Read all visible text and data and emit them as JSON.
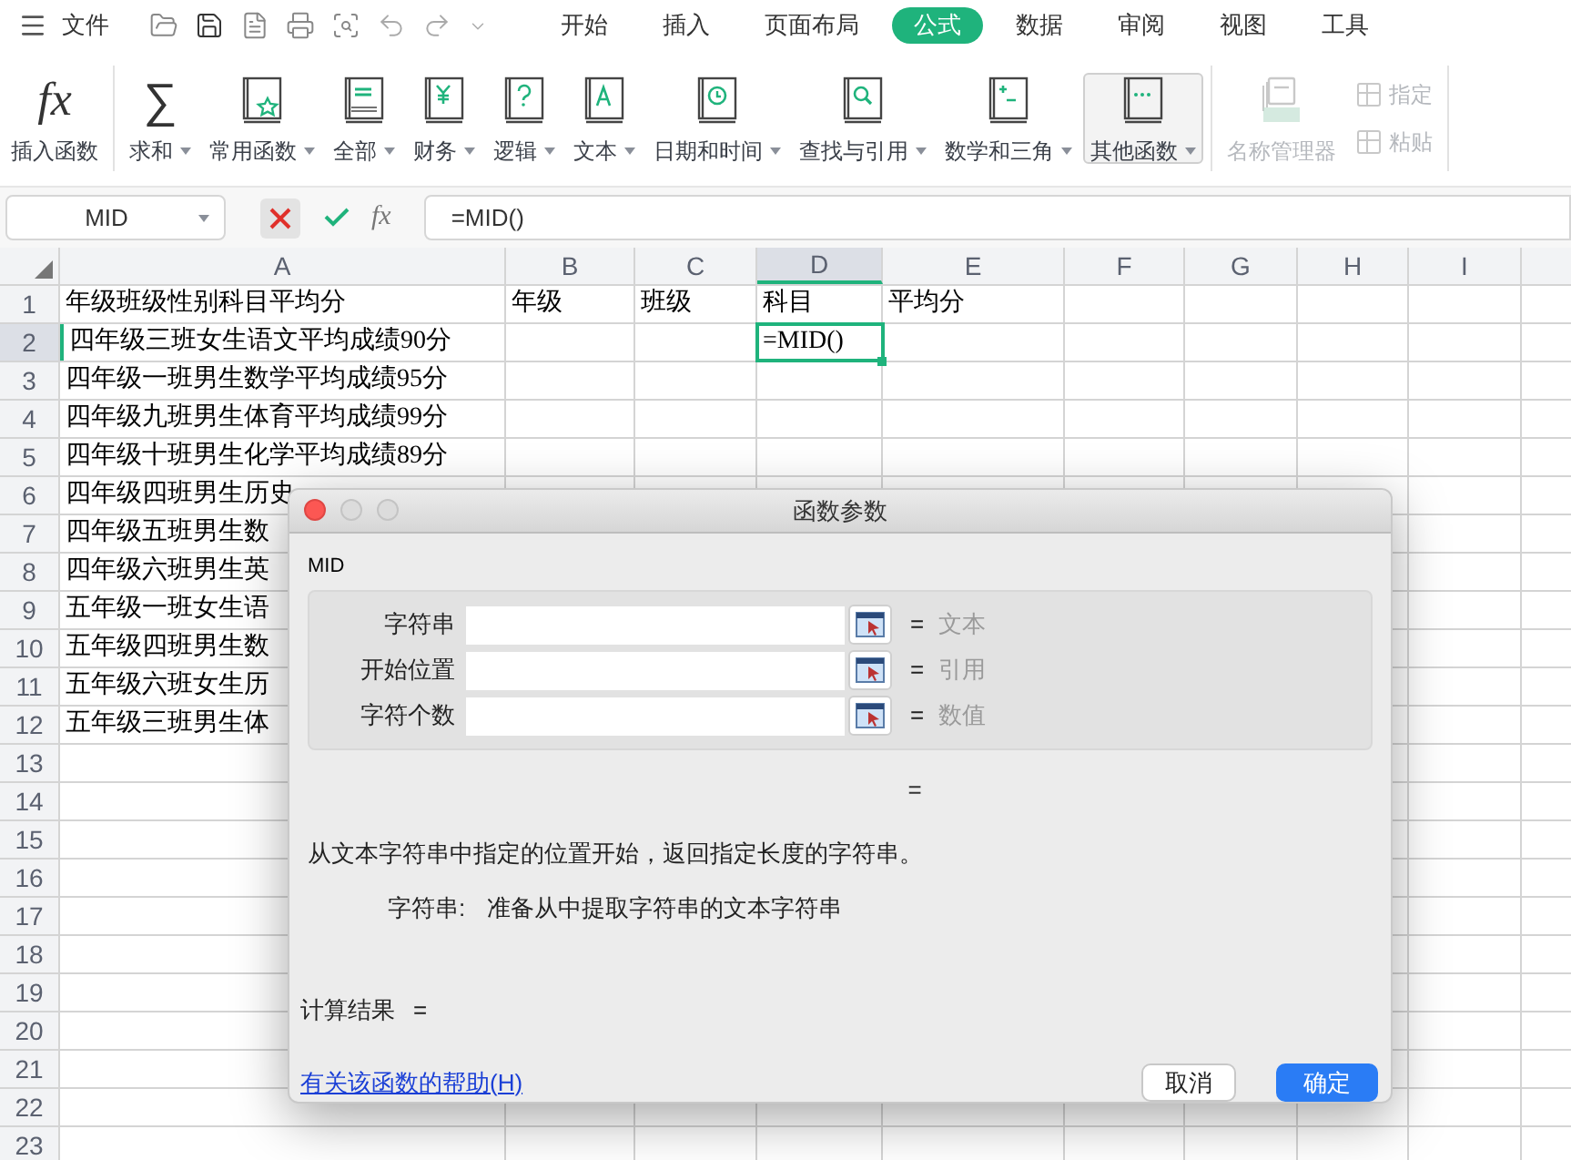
{
  "menu": {
    "file": "文件",
    "tabs": [
      {
        "label": "开始",
        "selected": false
      },
      {
        "label": "插入",
        "selected": false
      },
      {
        "label": "页面布局",
        "selected": false
      },
      {
        "label": "公式",
        "selected": true
      },
      {
        "label": "数据",
        "selected": false
      },
      {
        "label": "审阅",
        "selected": false
      },
      {
        "label": "视图",
        "selected": false
      },
      {
        "label": "工具",
        "selected": false
      }
    ]
  },
  "ribbon": {
    "items": [
      {
        "kind": "big",
        "glyph": "fx",
        "label": "插入函数",
        "dropdown": false,
        "disabled": false,
        "highlighted": false
      },
      {
        "kind": "big",
        "glyph": "∑",
        "label": "求和",
        "dropdown": true,
        "disabled": false,
        "highlighted": false
      },
      {
        "kind": "big",
        "label": "常用函数",
        "dropdown": true,
        "disabled": false,
        "highlighted": false
      },
      {
        "kind": "big",
        "label": "全部",
        "dropdown": true,
        "disabled": false,
        "highlighted": false
      },
      {
        "kind": "big",
        "label": "财务",
        "dropdown": true,
        "disabled": false,
        "highlighted": false
      },
      {
        "kind": "big",
        "label": "逻辑",
        "dropdown": true,
        "disabled": false,
        "highlighted": false
      },
      {
        "kind": "big",
        "label": "文本",
        "dropdown": true,
        "disabled": false,
        "highlighted": false
      },
      {
        "kind": "big",
        "label": "日期和时间",
        "dropdown": true,
        "disabled": false,
        "highlighted": false
      },
      {
        "kind": "big",
        "label": "查找与引用",
        "dropdown": true,
        "disabled": false,
        "highlighted": false
      },
      {
        "kind": "big",
        "label": "数学和三角",
        "dropdown": true,
        "disabled": false,
        "highlighted": false
      },
      {
        "kind": "big",
        "label": "其他函数",
        "dropdown": true,
        "disabled": false,
        "highlighted": true
      },
      {
        "kind": "big",
        "label": "名称管理器",
        "dropdown": false,
        "disabled": true,
        "highlighted": false
      },
      {
        "kind": "small",
        "label": "指定",
        "dropdown": false,
        "disabled": true,
        "highlighted": false
      },
      {
        "kind": "small",
        "label": "粘贴",
        "dropdown": false,
        "disabled": true,
        "highlighted": false
      }
    ]
  },
  "formula_bar": {
    "name_box": "MID",
    "fx": "fx",
    "formula": "=MID()"
  },
  "sheet": {
    "columns": [
      {
        "label": "A",
        "selected": false
      },
      {
        "label": "B",
        "selected": false
      },
      {
        "label": "C",
        "selected": false
      },
      {
        "label": "D",
        "selected": true
      },
      {
        "label": "E",
        "selected": false
      },
      {
        "label": "F",
        "selected": false
      },
      {
        "label": "G",
        "selected": false
      },
      {
        "label": "H",
        "selected": false
      },
      {
        "label": "I",
        "selected": false
      }
    ],
    "rows": [
      {
        "label": "1",
        "selected": false,
        "cells": {
          "A": "年级班级性别科目平均分",
          "B": "年级",
          "C": "班级",
          "D": "科目",
          "E": "平均分"
        }
      },
      {
        "label": "2",
        "selected": true,
        "cells": {
          "A": "四年级三班女生语文平均成绩90分",
          "D": "=MID()"
        }
      },
      {
        "label": "3",
        "selected": false,
        "cells": {
          "A": "四年级一班男生数学平均成绩95分"
        }
      },
      {
        "label": "4",
        "selected": false,
        "cells": {
          "A": "四年级九班男生体育平均成绩99分"
        }
      },
      {
        "label": "5",
        "selected": false,
        "cells": {
          "A": "四年级十班男生化学平均成绩89分"
        }
      },
      {
        "label": "6",
        "selected": false,
        "cells": {
          "A": "四年级四班男生历史"
        }
      },
      {
        "label": "7",
        "selected": false,
        "cells": {
          "A": "四年级五班男生数"
        }
      },
      {
        "label": "8",
        "selected": false,
        "cells": {
          "A": "四年级六班男生英"
        }
      },
      {
        "label": "9",
        "selected": false,
        "cells": {
          "A": "五年级一班女生语"
        }
      },
      {
        "label": "10",
        "selected": false,
        "cells": {
          "A": "五年级四班男生数"
        }
      },
      {
        "label": "11",
        "selected": false,
        "cells": {
          "A": "五年级六班女生历"
        }
      },
      {
        "label": "12",
        "selected": false,
        "cells": {
          "A": "五年级三班男生体"
        }
      },
      {
        "label": "13",
        "selected": false
      },
      {
        "label": "14",
        "selected": false
      },
      {
        "label": "15",
        "selected": false
      },
      {
        "label": "16",
        "selected": false
      },
      {
        "label": "17",
        "selected": false
      },
      {
        "label": "18",
        "selected": false
      },
      {
        "label": "19",
        "selected": false
      },
      {
        "label": "20",
        "selected": false
      },
      {
        "label": "21",
        "selected": false
      },
      {
        "label": "22",
        "selected": false
      },
      {
        "label": "23",
        "selected": false
      }
    ]
  },
  "dialog": {
    "title": "函数参数",
    "function": "MID",
    "params": [
      {
        "label": "字符串",
        "equals": "=",
        "hint": "文本"
      },
      {
        "label": "开始位置",
        "equals": "=",
        "hint": "引用"
      },
      {
        "label": "字符个数",
        "equals": "=",
        "hint": "数值"
      }
    ],
    "equals": "=",
    "result_equals": "=",
    "description": "从文本字符串中指定的位置开始，返回指定长度的字符串。",
    "arg_name": "字符串:",
    "arg_help": "准备从中提取字符串的文本字符串",
    "result_label": "计算结果",
    "help_link": "有关该函数的帮助(H)",
    "buttons": [
      {
        "label": "取消",
        "kind": "secondary"
      },
      {
        "label": "确定",
        "kind": "primary"
      }
    ]
  }
}
